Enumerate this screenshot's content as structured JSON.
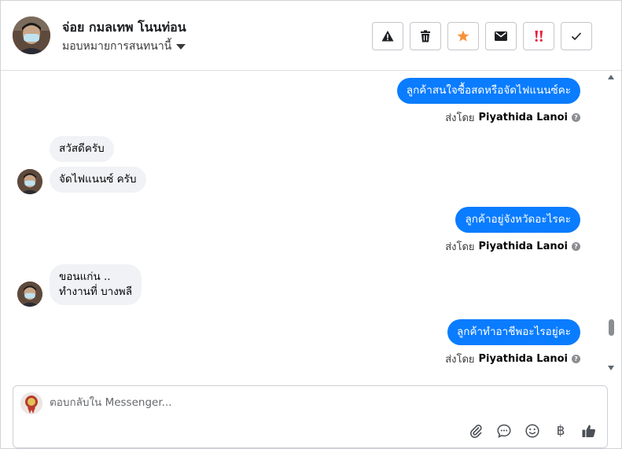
{
  "header": {
    "contact_name": "จ่อย กมลเทพ โนนท่อน",
    "assign_label": "มอบหมายการสนทนานี้",
    "actions": [
      {
        "name": "report-button",
        "icon": "warning-icon",
        "color": "#1c1e21"
      },
      {
        "name": "delete-button",
        "icon": "trash-icon",
        "color": "#1c1e21"
      },
      {
        "name": "star-button",
        "icon": "star-icon",
        "color": "#f7923b"
      },
      {
        "name": "mark-unread-button",
        "icon": "envelope-icon",
        "color": "#1c1e21"
      },
      {
        "name": "follow-up-button",
        "icon": "double-exclamation-icon",
        "color": "#e41e3f"
      },
      {
        "name": "mark-done-button",
        "icon": "check-icon",
        "color": "#1c1e21"
      }
    ]
  },
  "messages": {
    "outgoing": [
      {
        "text": "ลูกค้าสนใจซื้อสดหรือจัดไฟแนนซ์คะ",
        "sent_by_prefix": "ส่งโดย",
        "sender": "Piyathida Lanoi"
      },
      {
        "text": "ลูกค้าอยู่จังหวัดอะไรคะ",
        "sent_by_prefix": "ส่งโดย",
        "sender": "Piyathida Lanoi"
      },
      {
        "text": "ลูกค้าทำอาชีพอะไรอยู่คะ",
        "sent_by_prefix": "ส่งโดย",
        "sender": "Piyathida Lanoi"
      }
    ],
    "incoming": [
      {
        "text": "สวัสดีครับ"
      },
      {
        "text": "จัดไฟแนนซ์ ครับ"
      },
      {
        "line1": "ขอนแก่น ..",
        "line2": "ทำงานที่ บางพลี"
      }
    ],
    "info_glyph": "?"
  },
  "composer": {
    "placeholder": "ตอบกลับใน Messenger...",
    "tools": [
      {
        "name": "attach-button",
        "icon": "paperclip-icon"
      },
      {
        "name": "saved-replies-button",
        "icon": "speech-bubble-icon"
      },
      {
        "name": "emoji-button",
        "icon": "smiley-icon"
      },
      {
        "name": "payment-button",
        "icon": "baht-icon",
        "glyph": "฿"
      },
      {
        "name": "like-button",
        "icon": "thumbs-up-icon"
      }
    ]
  },
  "colors": {
    "outgoing_bubble": "#0a7cff",
    "incoming_bubble": "#f0f2f5",
    "star": "#f7923b",
    "follow_up": "#e41e3f"
  }
}
